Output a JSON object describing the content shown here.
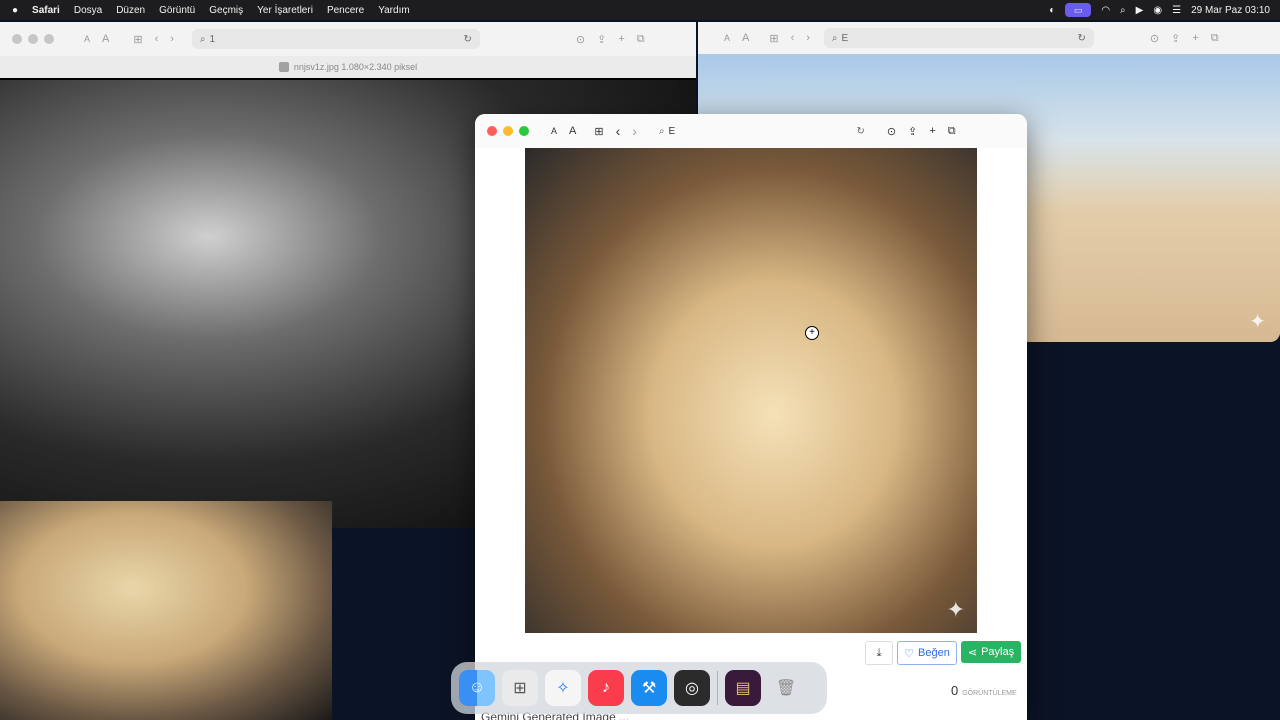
{
  "menubar": {
    "apple": "",
    "app": "Safari",
    "items": [
      "Dosya",
      "Düzen",
      "Görüntü",
      "Geçmiş",
      "Yer İşaretleri",
      "Pencere",
      "Yardım"
    ],
    "datetime": "29 Mar Paz  03:10"
  },
  "window_left": {
    "text_size_small": "A",
    "text_size_large": "A",
    "address": "1",
    "file_label": "nnjsv1z.jpg 1.080×2.340 piksel"
  },
  "window_right": {
    "text_size_small": "A",
    "text_size_large": "A",
    "address": "E"
  },
  "window_front": {
    "text_size_small": "A",
    "text_size_large": "A",
    "address": "E",
    "actions": {
      "like_label": "Beğen",
      "share_label": "Paylaş"
    },
    "views": {
      "count": "0",
      "label": "GÖRÜNTÜLEME"
    },
    "caption": "Gemini Generated Image ..."
  },
  "colors": {
    "share_green": "#28b463",
    "like_blue": "#2e6fd8",
    "desktop": "#0b1326"
  },
  "dock": {
    "apps": [
      "finder-icon",
      "launchpad-icon",
      "safari-icon",
      "music-icon",
      "xcode-icon",
      "obs-icon",
      "app-icon",
      "trash-icon"
    ]
  }
}
